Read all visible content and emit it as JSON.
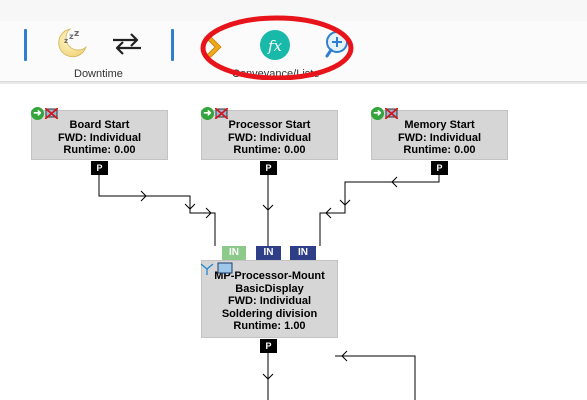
{
  "ribbon": {
    "downtime_label": "Downtime",
    "conveyance_label": "Conveyance/Liste"
  },
  "nodes": {
    "board": {
      "title": "Board Start",
      "mode": "FWD: Individual",
      "runtime": "Runtime: 0.00",
      "port": "P"
    },
    "processor": {
      "title": "Processor Start",
      "mode": "FWD: Individual",
      "runtime": "Runtime: 0.00",
      "port": "P"
    },
    "memory": {
      "title": "Memory Start",
      "mode": "FWD: Individual",
      "runtime": "Runtime: 0.00",
      "port": "P"
    },
    "mount": {
      "line1": "MP-Processor-Mount",
      "line2": "BasicDisplay",
      "mode": "FWD: Individual",
      "division": "Soldering division",
      "runtime": "Runtime: 1.00",
      "port": "P",
      "inputs": [
        "IN",
        "IN",
        "IN"
      ]
    }
  },
  "colors": {
    "in_green": "#8dc98a",
    "in_navy": "#2e3f88",
    "annotation_red": "#e8141b",
    "divider_blue": "#2f7fd0",
    "function_teal": "#19b9a9"
  },
  "icons": [
    "sleep-moon-icon",
    "swap-arrows-icon",
    "conveyance-chevron-icon",
    "function-fx-icon",
    "zoom-in-icon"
  ]
}
